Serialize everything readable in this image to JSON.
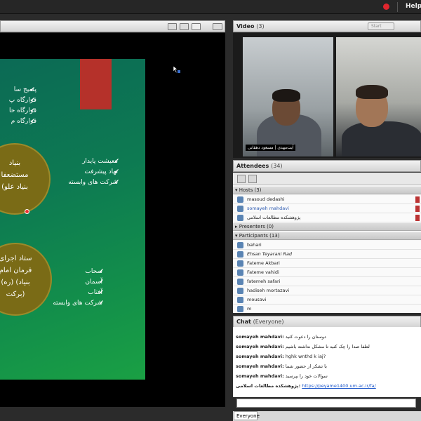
{
  "topbar": {
    "help_label": "Help"
  },
  "share": {
    "slide": {
      "top_list": [
        "پسیج سا",
        "قرارگاه پ",
        "قرارگاه خا",
        "قرارگاه م"
      ],
      "circle1": [
        "بنیاد",
        "مستضعفا",
        "(بنیاد علو"
      ],
      "list1": [
        "معیشت پایدار",
        "نهاد پیشرفت",
        "شرکت های وابسته"
      ],
      "circle2": [
        "ستاد اجرای",
        "فرمان امام",
        "(ره) (بنیاد",
        "برکت)"
      ],
      "list2": [
        "سحاب",
        "آسمان",
        "آفتاب",
        "شرکت های وابسته"
      ]
    }
  },
  "video": {
    "title": "Video",
    "count": "(3)",
    "start_label": "Start",
    "feed1_name": "آیت‌مهدی | مسعود دهقانی"
  },
  "attendees": {
    "title": "Attendees",
    "count": "(34)",
    "hosts_label": "Hosts (3)",
    "hosts": [
      "masoud dedashi",
      "somayeh mahdavi",
      "پژوهشکده مطالعات اسلامی"
    ],
    "presenters_label": "Presenters (0)",
    "participants_label": "Participants (13)",
    "participants": [
      "bahari",
      "Ehsan Teyarani Rad",
      "Fateme Akbari",
      "Fateme vahidi",
      "fatemeh safari",
      "hadiseh mortazavi",
      "mousavi",
      "m"
    ]
  },
  "chat": {
    "title": "Chat",
    "scope": "(Everyone)",
    "messages": [
      {
        "sender": "somayeh mahdavi:",
        "text": "دوستان را دعوت کنید"
      },
      {
        "sender": "somayeh mahdavi:",
        "text": "لطفا صدا را چک کنید تا مشکل نداشته باشیم"
      },
      {
        "sender": "somayeh mahdavi:",
        "text": "hghk wnthd k iaj?"
      },
      {
        "sender": "somayeh mahdavi:",
        "text": "با تشکر از حضور شما"
      },
      {
        "sender": "somayeh mahdavi:",
        "text": "سوالات خود را بپرسید"
      },
      {
        "sender": "پژوهشکده مطالعات اسلامی:",
        "text": "",
        "link": "https://peyame1400.um.ac.ir/fa/"
      }
    ],
    "to_label": "Everyone"
  }
}
